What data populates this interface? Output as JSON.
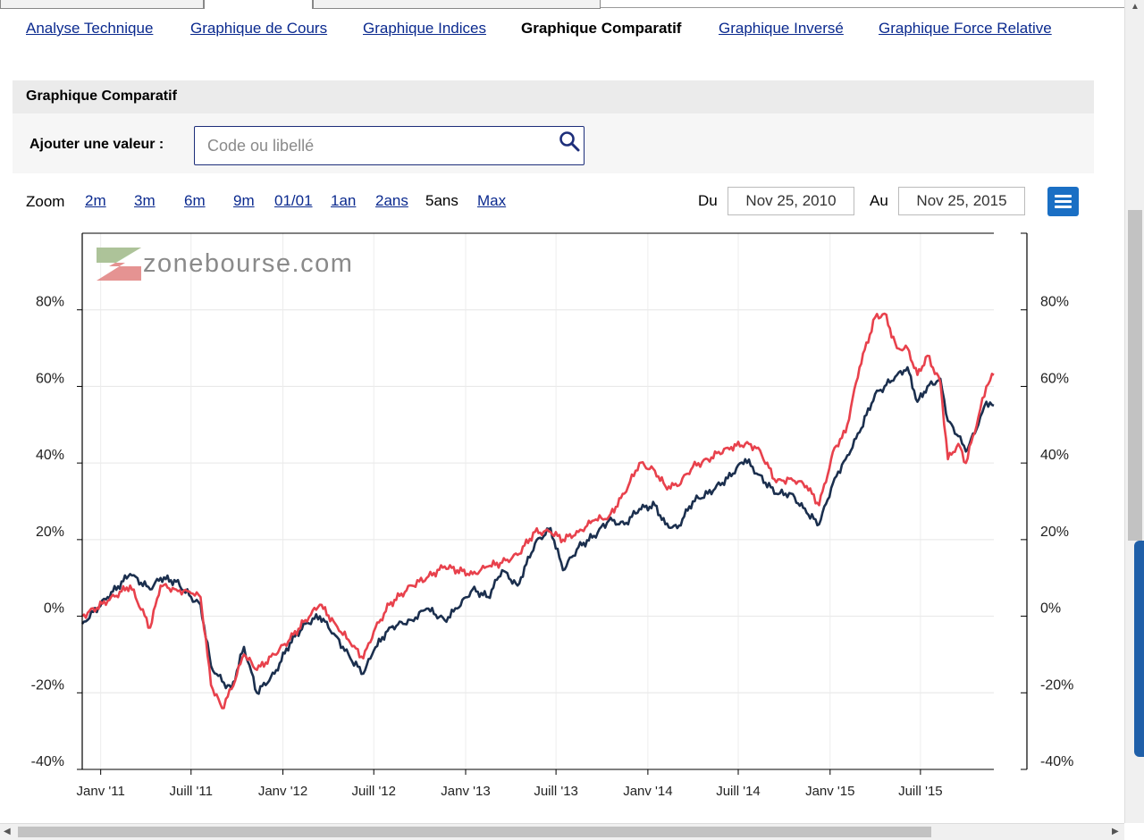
{
  "nav": {
    "links": [
      {
        "label": "Analyse Technique"
      },
      {
        "label": "Graphique de Cours"
      },
      {
        "label": "Graphique Indices"
      },
      {
        "label": "Graphique Comparatif"
      },
      {
        "label": "Graphique Inversé"
      },
      {
        "label": "Graphique Force Relative"
      }
    ],
    "current": "Graphique Comparatif"
  },
  "panel": {
    "title": "Graphique Comparatif",
    "add_label": "Ajouter une valeur :",
    "search_placeholder": "Code ou libellé",
    "search_icon": "search-icon"
  },
  "toolbar": {
    "zoom_label": "Zoom",
    "zoom_options": [
      "2m",
      "3m",
      "6m",
      "9m",
      "01/01",
      "1an",
      "2ans",
      "5ans",
      "Max"
    ],
    "selected_zoom": "5ans",
    "from_label": "Du",
    "from_date": "Nov 25, 2010",
    "to_label": "Au",
    "to_date": "Nov 25, 2015",
    "menu_icon": "hamburger-menu-icon",
    "menu_color": "#1a6fc4"
  },
  "chart_data": {
    "type": "line",
    "watermark": "zonebourse.com",
    "y_ticks": [
      "-40%",
      "-20%",
      "0%",
      "20%",
      "40%",
      "60%",
      "80%"
    ],
    "ylim": [
      -40,
      100
    ],
    "x_ticks": [
      "Janv '11",
      "Juill '11",
      "Janv '12",
      "Juill '12",
      "Janv '13",
      "Juill '13",
      "Janv '14",
      "Juill '14",
      "Janv '15",
      "Juill '15"
    ],
    "x_tick_dates": [
      "2011-01-01",
      "2011-07-01",
      "2012-01-01",
      "2012-07-01",
      "2013-01-01",
      "2013-07-01",
      "2014-01-01",
      "2014-07-01",
      "2015-01-01",
      "2015-07-01"
    ],
    "xlim": [
      "2010-11-25",
      "2015-11-25"
    ],
    "grid": true,
    "series": [
      {
        "color": "#1b2f4e",
        "x": [
          "2010-11-25",
          "2011-01-15",
          "2011-03-01",
          "2011-04-10",
          "2011-05-01",
          "2011-06-01",
          "2011-07-01",
          "2011-07-20",
          "2011-08-10",
          "2011-09-01",
          "2011-09-20",
          "2011-10-15",
          "2011-11-10",
          "2011-12-15",
          "2012-01-15",
          "2012-02-15",
          "2012-03-15",
          "2012-04-15",
          "2012-05-15",
          "2012-06-10",
          "2012-07-01",
          "2012-08-01",
          "2012-09-15",
          "2012-10-15",
          "2012-11-20",
          "2012-12-15",
          "2013-01-15",
          "2013-02-15",
          "2013-03-15",
          "2013-04-15",
          "2013-05-20",
          "2013-06-20",
          "2013-07-15",
          "2013-08-15",
          "2013-09-15",
          "2013-10-15",
          "2013-11-15",
          "2013-12-15",
          "2014-01-15",
          "2014-02-05",
          "2014-03-01",
          "2014-04-01",
          "2014-05-01",
          "2014-06-10",
          "2014-07-15",
          "2014-08-10",
          "2014-09-15",
          "2014-10-15",
          "2014-11-15",
          "2014-12-10",
          "2015-01-10",
          "2015-02-01",
          "2015-03-01",
          "2015-04-01",
          "2015-04-20",
          "2015-05-15",
          "2015-06-05",
          "2015-06-25",
          "2015-07-15",
          "2015-08-10",
          "2015-08-25",
          "2015-09-15",
          "2015-09-30",
          "2015-10-25",
          "2015-11-10",
          "2015-11-25"
        ],
        "y": [
          -2,
          5,
          11,
          7,
          10,
          9,
          5,
          3,
          -13,
          -17,
          -19,
          -8,
          -20,
          -15,
          -7,
          -2,
          0,
          -5,
          -11,
          -15,
          -9,
          -3,
          -1,
          2,
          -1,
          2,
          7,
          5,
          12,
          8,
          19,
          23,
          12,
          18,
          21,
          25,
          24,
          28,
          29,
          24,
          23,
          30,
          32,
          36,
          41,
          37,
          32,
          32,
          27,
          24,
          36,
          41,
          48,
          58,
          60,
          63,
          65,
          56,
          60,
          62,
          51,
          47,
          43,
          50,
          56,
          55
        ]
      },
      {
        "color": "#e8414c",
        "x": [
          "2010-11-25",
          "2011-01-15",
          "2011-03-01",
          "2011-04-10",
          "2011-05-01",
          "2011-06-01",
          "2011-07-01",
          "2011-07-20",
          "2011-08-10",
          "2011-09-01",
          "2011-09-20",
          "2011-10-15",
          "2011-11-10",
          "2011-12-15",
          "2012-01-15",
          "2012-02-15",
          "2012-03-15",
          "2012-04-15",
          "2012-05-15",
          "2012-06-10",
          "2012-07-01",
          "2012-08-01",
          "2012-09-15",
          "2012-10-15",
          "2012-11-20",
          "2012-12-15",
          "2013-01-15",
          "2013-02-15",
          "2013-03-15",
          "2013-04-15",
          "2013-05-20",
          "2013-06-20",
          "2013-07-15",
          "2013-08-15",
          "2013-09-15",
          "2013-10-15",
          "2013-11-15",
          "2013-12-15",
          "2014-01-15",
          "2014-02-05",
          "2014-03-01",
          "2014-04-01",
          "2014-05-01",
          "2014-06-10",
          "2014-07-15",
          "2014-08-10",
          "2014-09-15",
          "2014-10-15",
          "2014-11-15",
          "2014-12-10",
          "2015-01-10",
          "2015-02-01",
          "2015-03-01",
          "2015-04-01",
          "2015-04-20",
          "2015-05-15",
          "2015-06-05",
          "2015-06-25",
          "2015-07-15",
          "2015-08-10",
          "2015-08-25",
          "2015-09-15",
          "2015-09-30",
          "2015-10-25",
          "2015-11-10",
          "2015-11-25"
        ],
        "y": [
          0,
          4,
          8,
          -3,
          8,
          7,
          6,
          5,
          -18,
          -24,
          -19,
          -10,
          -14,
          -10,
          -6,
          -1,
          3,
          -2,
          -7,
          -11,
          -4,
          3,
          8,
          10,
          13,
          12,
          11,
          13,
          14,
          16,
          22,
          22,
          20,
          22,
          25,
          26,
          32,
          40,
          38,
          34,
          34,
          39,
          41,
          44,
          45,
          44,
          35,
          36,
          34,
          29,
          44,
          48,
          65,
          78,
          79,
          70,
          70,
          63,
          68,
          61,
          41,
          45,
          40,
          52,
          60,
          63
        ]
      }
    ]
  }
}
